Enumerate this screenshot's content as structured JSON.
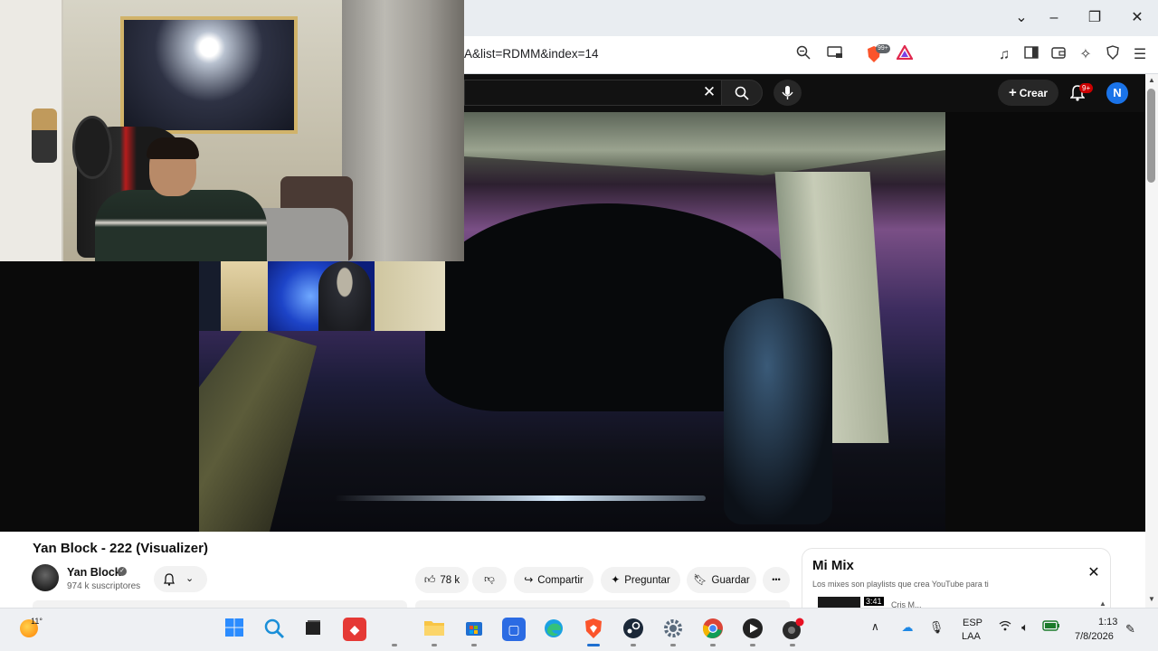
{
  "browser": {
    "url": "A&list=RDMM&index=14",
    "window_buttons": {
      "minimize": "–",
      "restore": "❐",
      "close": "✕",
      "tabs_dropdown": "⌄"
    },
    "brave_badge": "99+",
    "icons": [
      "zoom-icon",
      "cast-icon",
      "brave-shields-icon",
      "brave-rewards-icon",
      "music-queue-icon",
      "sidebar-icon",
      "wallet-icon",
      "leo-ai-icon",
      "vpn-icon",
      "menu-icon"
    ]
  },
  "youtube": {
    "search": {
      "clear": "✕"
    },
    "create_label": "Crear",
    "notifications_count": "9+",
    "account_initial": "N",
    "video": {
      "title": "Yan Block - 222 (Visualizer)",
      "channel": "Yan Block",
      "subscribers": "974 k suscriptores",
      "likes": "78 k",
      "actions": {
        "share": "Compartir",
        "ask": "Preguntar",
        "save": "Guardar",
        "more": "•••"
      }
    },
    "mix": {
      "title": "Mi Mix",
      "subtitle": "Los mixes son playlists que crea YouTube para ti",
      "first_item_duration": "3:41",
      "first_item_artist": "Cris M..."
    }
  },
  "taskbar": {
    "weather_temp": "11°",
    "apps": [
      "windows-start",
      "search",
      "task-view",
      "anydesk",
      "file-explorer",
      "microsoft-store",
      "app-store",
      "edge",
      "brave",
      "steam",
      "settings",
      "chrome",
      "media-player",
      "recording-app"
    ],
    "language_1": "ESP",
    "language_2": "LAA",
    "time": "1:13",
    "date": "7/8/2026"
  },
  "colors": {
    "yt_dark": "#0f0f0f",
    "accent_red": "#cc0000",
    "avatar_blue": "#1a73e8",
    "taskbar_bg": "#eef0f3"
  }
}
